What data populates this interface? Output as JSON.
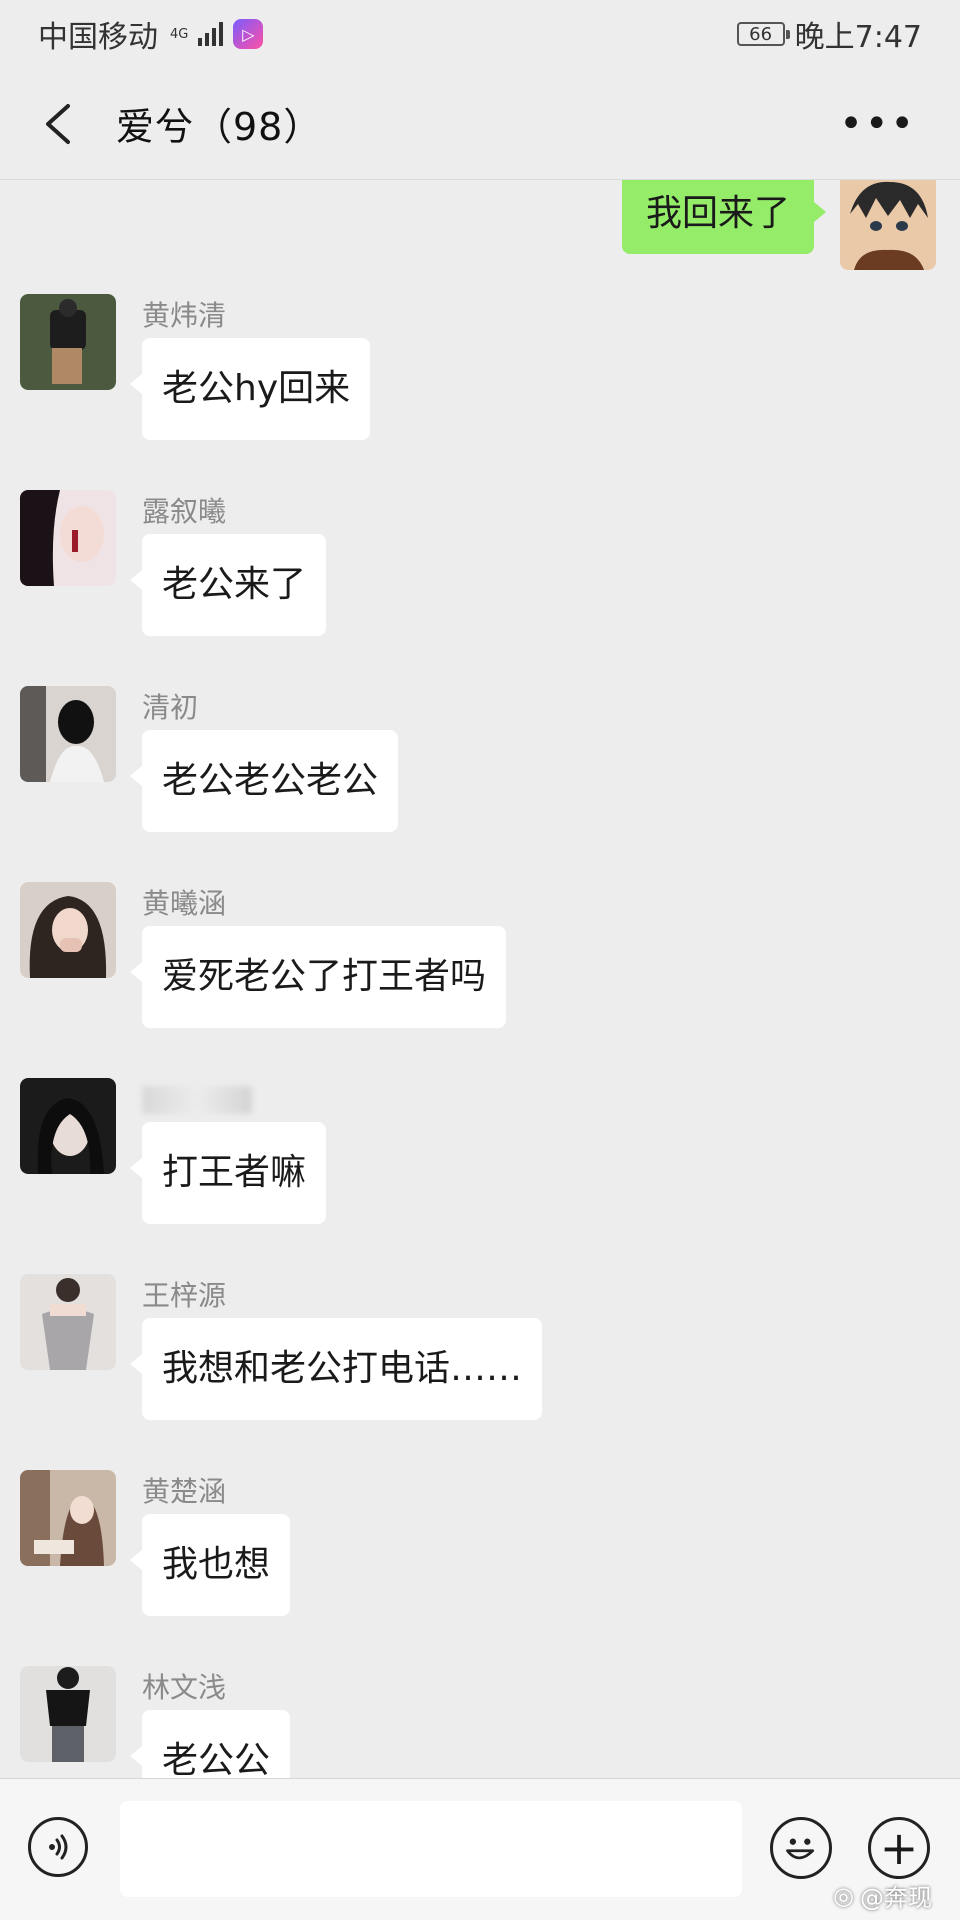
{
  "status_bar": {
    "carrier": "中国移动",
    "network": "4G",
    "battery": "66",
    "time": "晚上7:47"
  },
  "header": {
    "title": "爱兮（98）"
  },
  "my_message": {
    "text": "我回来了"
  },
  "messages": [
    {
      "sender": "黄炜清",
      "text": "老公hy回来"
    },
    {
      "sender": "露叙曦",
      "text": "老公来了"
    },
    {
      "sender": "清初",
      "text": "老公老公老公"
    },
    {
      "sender": "黄曦涵",
      "text": "爱死老公了打王者吗"
    },
    {
      "sender": "",
      "text": "打王者嘛"
    },
    {
      "sender": "王梓源",
      "text": "我想和老公打电话……"
    },
    {
      "sender": "黄楚涵",
      "text": "我也想"
    },
    {
      "sender": "林文浅",
      "text": "老公公"
    }
  ],
  "input_bar": {
    "placeholder": ""
  },
  "watermark": "@奔现",
  "colors": {
    "background": "#ededed",
    "my_bubble": "#95ec69",
    "other_bubble": "#ffffff"
  }
}
